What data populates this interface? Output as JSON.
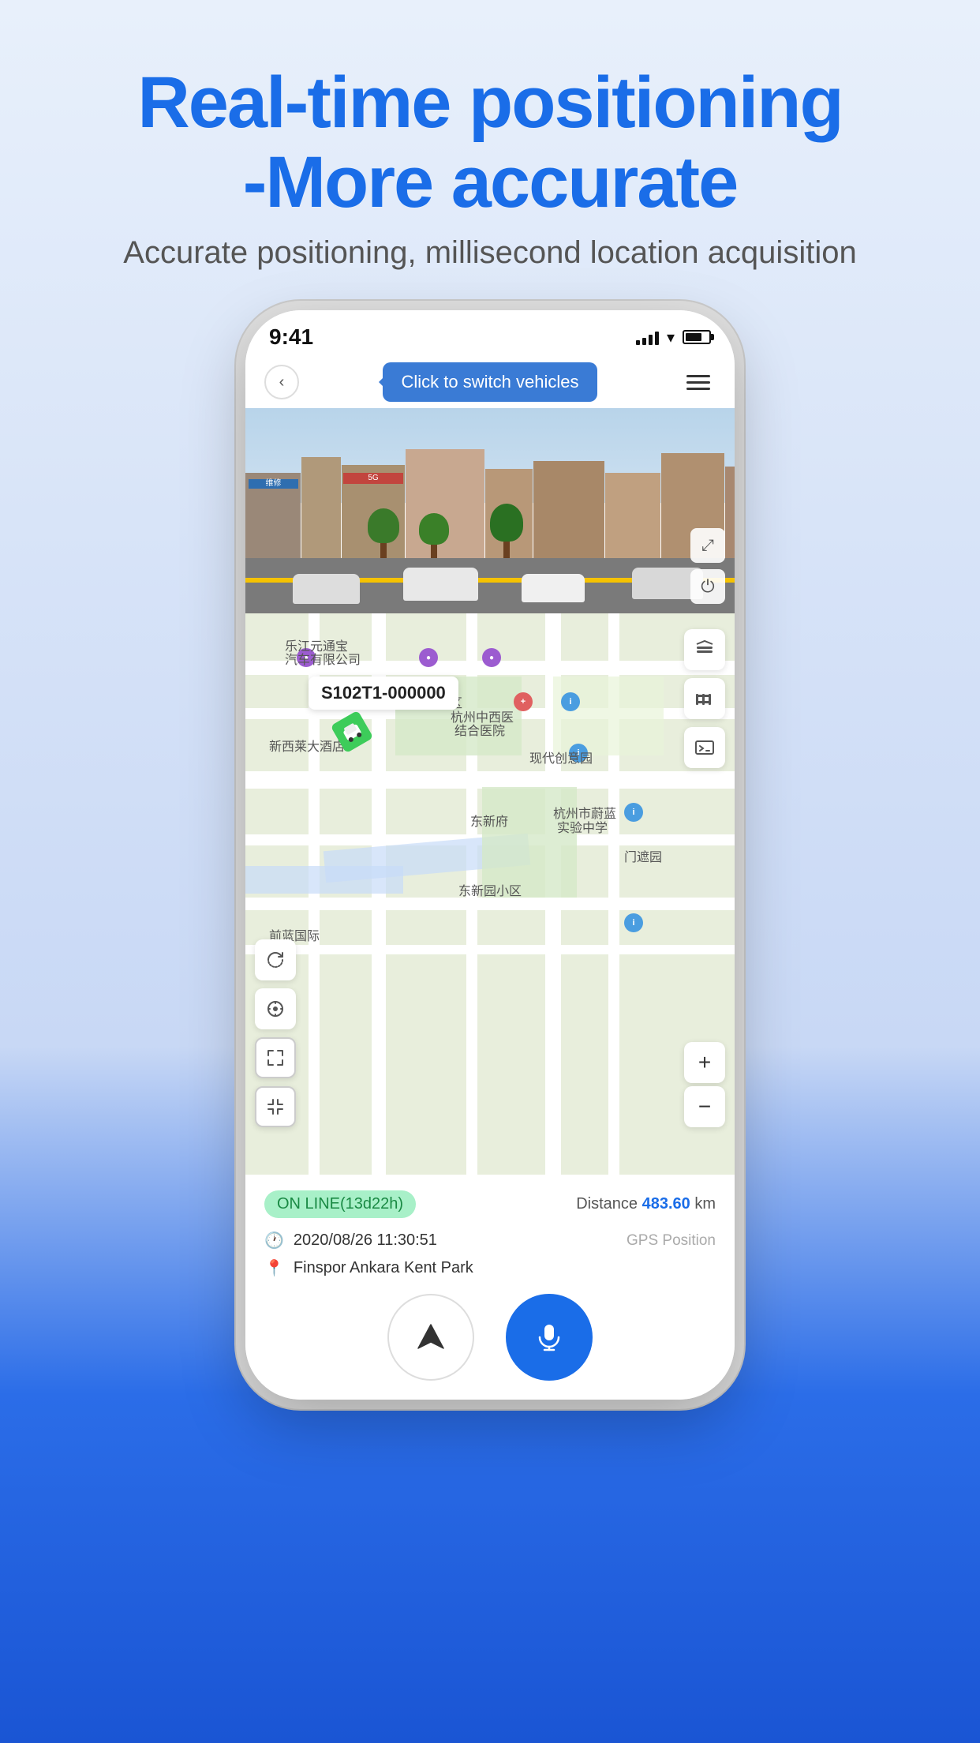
{
  "header": {
    "title_line1": "Real-time positioning",
    "title_line2": "-More accurate",
    "subtitle": "Accurate positioning, millisecond location acquisition"
  },
  "status_bar": {
    "time": "9:41",
    "signal_level": 4,
    "wifi": true,
    "battery": 70
  },
  "nav": {
    "tooltip": "Click to switch vehicles",
    "back_icon": "‹",
    "menu_icon": "≡"
  },
  "street_view": {
    "expand_icon": "⤢",
    "power_icon": "⏻"
  },
  "map": {
    "vehicle_id": "S102T1-000000",
    "layers_icon": "layers",
    "fence_icon": "fence",
    "terminal_icon": "terminal",
    "refresh_icon": "↻",
    "location_icon": "◎",
    "frame_expand_icon": "⤡",
    "frame_shrink_icon": "⤢",
    "zoom_in": "+",
    "zoom_out": "−"
  },
  "bottom_panel": {
    "status_badge": "ON LINE(13d22h)",
    "distance_label": "Distance",
    "distance_value": "483.60",
    "distance_unit": "km",
    "datetime": "2020/08/26 11:30:51",
    "gps_label": "GPS Position",
    "location": "Finspor Ankara Kent Park"
  },
  "action_buttons": {
    "navigate_label": "navigate",
    "mic_label": "mic"
  }
}
